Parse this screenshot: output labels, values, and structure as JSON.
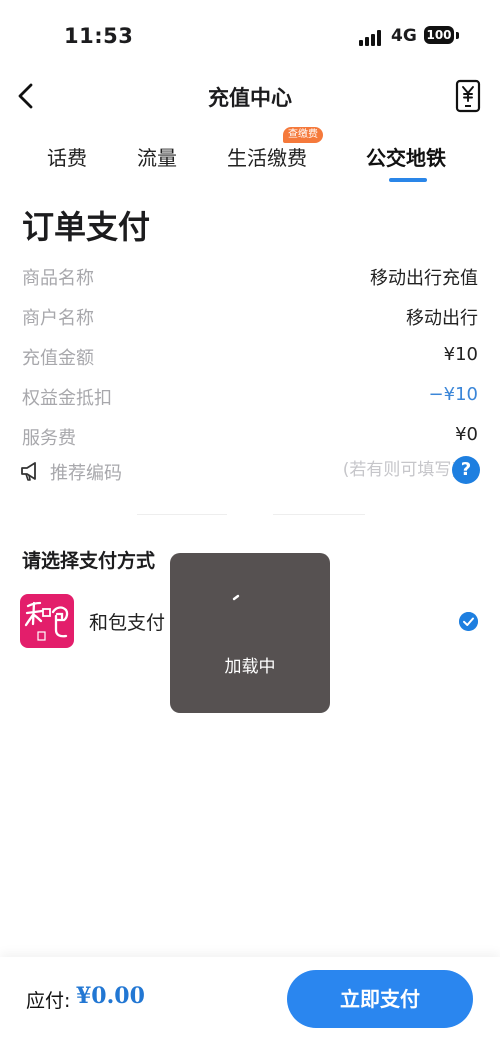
{
  "status_bar": {
    "time": "11:53",
    "network": "4G",
    "battery": "100"
  },
  "header": {
    "title": "充值中心",
    "back_icon": "chevron-left-icon",
    "bill_icon": "yuan-phone-icon"
  },
  "tabs": [
    {
      "label": "话费",
      "active": false
    },
    {
      "label": "流量",
      "active": false
    },
    {
      "label": "生活缴费",
      "active": false,
      "badge": "查缴费"
    },
    {
      "label": "公交地铁",
      "active": true
    }
  ],
  "order": {
    "title": "订单支付",
    "rows": [
      {
        "label": "商品名称",
        "value": "移动出行充值"
      },
      {
        "label": "商户名称",
        "value": "移动出行"
      },
      {
        "label": "充值金额",
        "value": "¥10"
      },
      {
        "label": "权益金抵扣",
        "value": "−¥10"
      },
      {
        "label": "服务费",
        "value": "¥0"
      }
    ],
    "referral": {
      "label": "推荐编码",
      "placeholder": "(若有则可填写)",
      "value": "",
      "help": "?"
    }
  },
  "payment": {
    "title": "请选择支付方式",
    "options": [
      {
        "name": "和包支付",
        "logo_text": "和包",
        "selected": true
      }
    ]
  },
  "loading": {
    "text": "加载中"
  },
  "footer": {
    "due_label": "应付:",
    "due_amount": "¥0.00",
    "pay_button": "立即支付"
  },
  "colors": {
    "accent": "#2a86ef",
    "discount": "#3b86d8",
    "badge": "#f5793b",
    "hebao_brand": "#e31e6b"
  }
}
